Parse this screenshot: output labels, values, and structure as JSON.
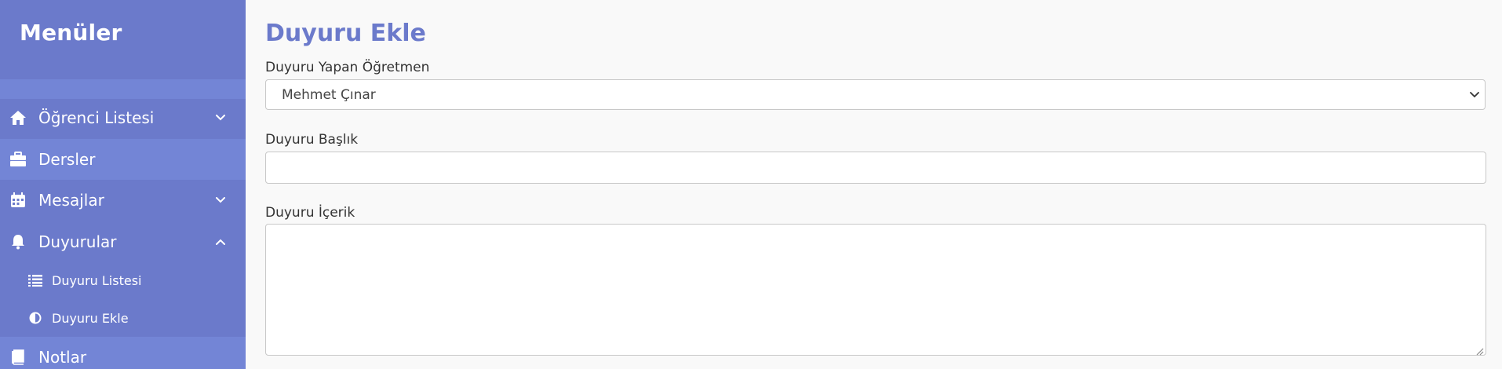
{
  "sidebar": {
    "title": "Menüler",
    "items": [
      {
        "label": "Öğrenci Listesi",
        "icon": "home-icon",
        "has_chevron": true,
        "chevron": "down"
      },
      {
        "label": "Dersler",
        "icon": "briefcase-icon",
        "has_chevron": false
      },
      {
        "label": "Mesajlar",
        "icon": "calendar-icon",
        "has_chevron": true,
        "chevron": "down"
      },
      {
        "label": "Duyurular",
        "icon": "bell-icon",
        "has_chevron": true,
        "chevron": "up"
      },
      {
        "label": "Notlar",
        "icon": "book-icon",
        "has_chevron": false
      }
    ],
    "sub_items": [
      {
        "label": "Duyuru Listesi",
        "icon": "list-icon"
      },
      {
        "label": "Duyuru Ekle",
        "icon": "half-circle-icon"
      }
    ]
  },
  "main": {
    "title": "Duyuru Ekle",
    "fields": {
      "teacher_label": "Duyuru Yapan Öğretmen",
      "teacher_value": "Mehmet Çınar",
      "title_label": "Duyuru Başlık",
      "title_value": "",
      "content_label": "Duyuru İçerik",
      "content_value": ""
    }
  },
  "colors": {
    "sidebar_bg": "#6b7acb",
    "sidebar_band": "#7385d6",
    "accent": "#6b7acb",
    "main_bg": "#f9f9f9"
  }
}
